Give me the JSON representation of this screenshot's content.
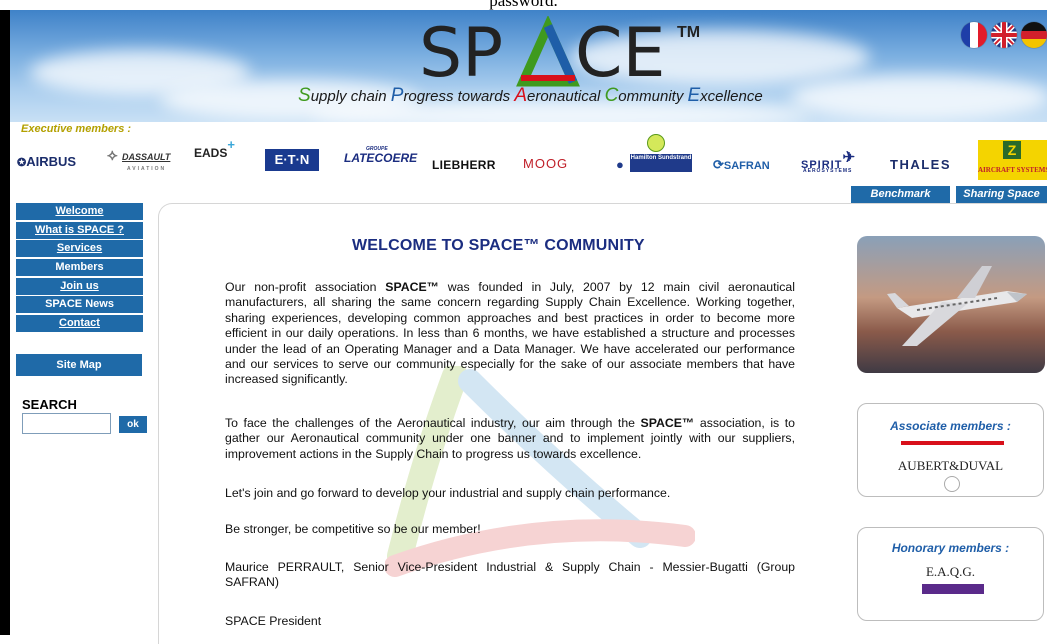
{
  "top_cropped_text": "password.",
  "header": {
    "logo_text": "SPACE",
    "trademark": "TM",
    "tagline": [
      {
        "cap": "S",
        "rest": "upply chain ",
        "color": "#3f9a1e"
      },
      {
        "cap": "P",
        "rest": "rogress towards ",
        "color": "#1f5ea8"
      },
      {
        "cap": "A",
        "rest": "eronautical ",
        "color": "#d8101a"
      },
      {
        "cap": "C",
        "rest": "ommunity ",
        "color": "#3f9a1e"
      },
      {
        "cap": "E",
        "rest": "xcellence",
        "color": "#1f5ea8"
      }
    ],
    "flags": [
      "french-flag",
      "uk-flag",
      "german-flag"
    ]
  },
  "executive_label": "Executive members :",
  "executive_members": [
    {
      "name": "AIRBUS",
      "color": "#1b2d6b"
    },
    {
      "name": "DASSAULT",
      "sub": "AVIATION",
      "color": "#333333"
    },
    {
      "name": "EADS",
      "color": "#222222"
    },
    {
      "name": "E·T·N",
      "color": "#ffffff"
    },
    {
      "name": "LATECOERE",
      "sub": "GROUPE",
      "color": "#1b2d80"
    },
    {
      "name": "LIEBHERR",
      "color": "#111111"
    },
    {
      "name": "MOOG",
      "color": "#c0202a"
    },
    {
      "name": "Hamilton Sundstrand",
      "color": "#1f3a8a"
    },
    {
      "name": "SAFRAN",
      "color": "#1f5ea8"
    },
    {
      "name": "SPIRIT",
      "sub": "AEROSYSTEMS",
      "color": "#1b2d80"
    },
    {
      "name": "THALES",
      "color": "#1b2d6b"
    },
    {
      "name": "AIRCRAFT SYSTEMS",
      "color": "#c0202a"
    }
  ],
  "top_tabs": {
    "benchmark": "Benchmark",
    "sharing": "Sharing Space"
  },
  "nav": {
    "items": [
      {
        "label": "Welcome",
        "underline": true
      },
      {
        "label": "What is SPACE ?",
        "underline": true
      },
      {
        "label": "Services",
        "underline": true
      },
      {
        "label": "Members",
        "underline": false
      },
      {
        "label": "Join us",
        "underline": true
      },
      {
        "label": "SPACE News",
        "underline": false
      },
      {
        "label": "Contact",
        "underline": true
      }
    ],
    "site_map": "Site Map"
  },
  "search": {
    "title": "SEARCH",
    "value": "",
    "button": "ok"
  },
  "main": {
    "title": "WELCOME TO SPACE™ COMMUNITY",
    "p1_a": "Our non-profit association ",
    "p1_b": "SPACE™",
    "p1_c": " was founded in July, 2007 by 12 main civil aeronautical manufacturers, all sharing the same concern regarding Supply Chain Excellence. Working together, sharing experiences, developing common approaches and best practices in order to become more efficient in our daily operations. In less than 6 months, we have established a structure and processes under the lead of an Operating Manager and a Data Manager. We have accelerated our performance and our services to serve our community especially for the sake of our associate members that have increased significantly.",
    "p2_a": "To face the challenges of the Aeronautical industry, our aim through the ",
    "p2_b": "SPACE™",
    "p2_c": " association, is to gather our Aeronautical community under one banner and to implement jointly with our suppliers, improvement actions in the Supply Chain to progress us towards excellence.",
    "p3": "Let's join and go forward to develop your industrial and supply chain performance.",
    "p4": "Be stronger, be competitive so be our member!",
    "p5": "Maurice PERRAULT, Senior Vice-President Industrial & Supply Chain - Messier-Bugatti (Group SAFRAN)",
    "p6": "SPACE President"
  },
  "right": {
    "associate_title": "Associate members :",
    "associate_logo": "AUBERT&DUVAL",
    "honorary_title": "Honorary members :",
    "honorary_logo": "E.A.Q.G."
  }
}
